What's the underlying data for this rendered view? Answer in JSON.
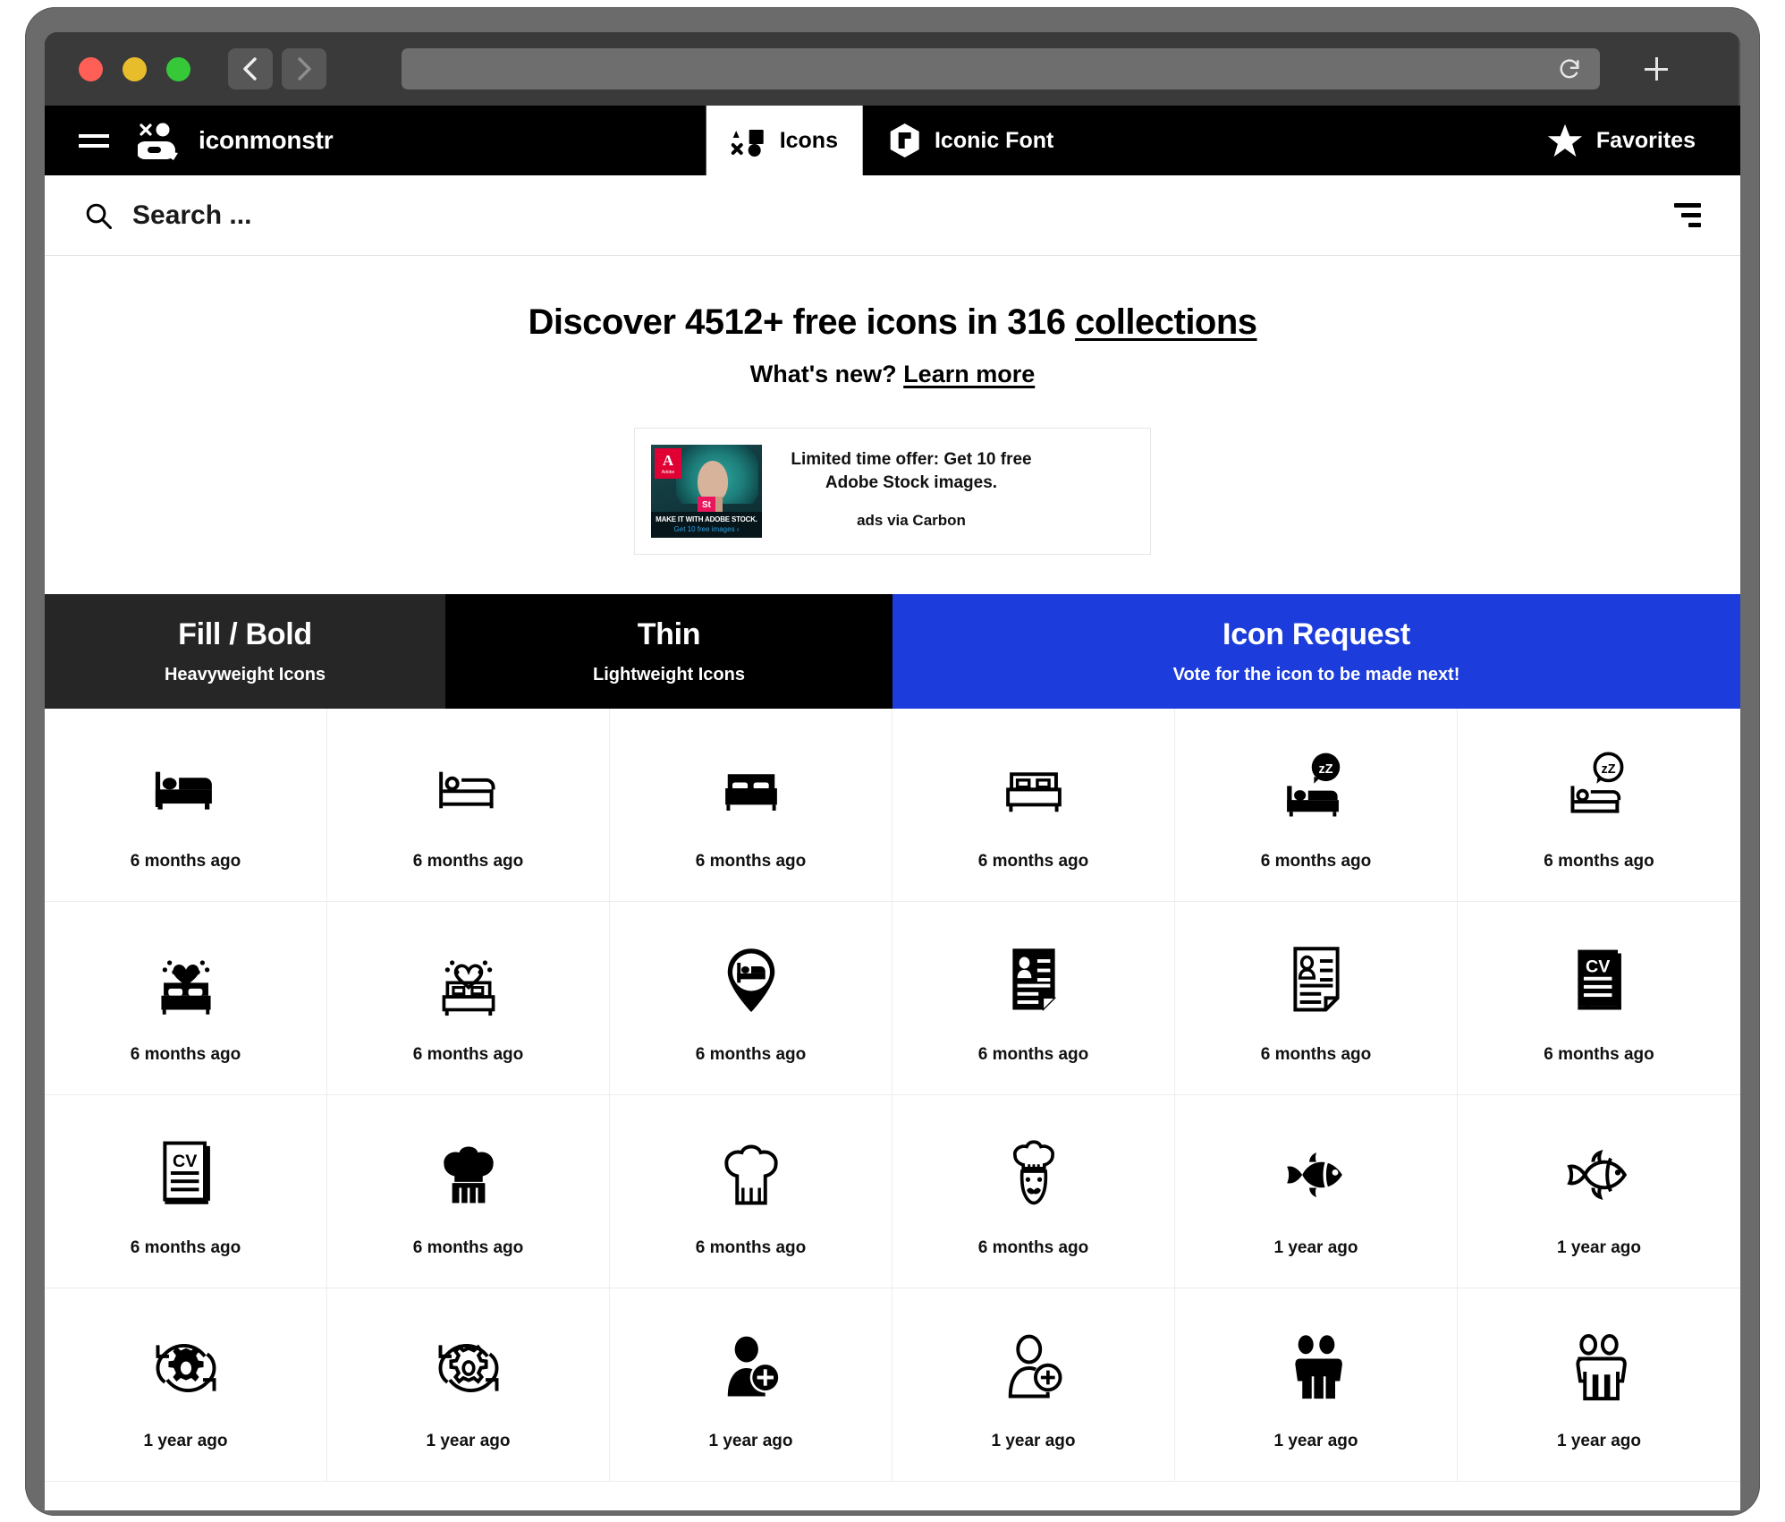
{
  "browser": {
    "traffic_lights": [
      "close",
      "minimize",
      "maximize"
    ],
    "back_label": "Back",
    "forward_label": "Forward",
    "reload_label": "Reload",
    "url_value": "",
    "new_tab_label": "New Tab"
  },
  "topnav": {
    "menu_label": "Menu",
    "brand": "iconmonstr",
    "tabs": [
      {
        "label": "Icons",
        "icon": "shapes-icon",
        "active": true
      },
      {
        "label": "Iconic Font",
        "icon": "hexagon-font-icon",
        "active": false
      }
    ],
    "favorites_label": "Favorites"
  },
  "search": {
    "placeholder": "Search ...",
    "value": "",
    "filter_label": "Filter"
  },
  "hero": {
    "headline_prefix": "Discover 4512+ free icons in 316 ",
    "headline_link": "collections",
    "icon_count": "4512+",
    "collection_count": "316",
    "sub_prefix": "What's new? ",
    "sub_link": "Learn more"
  },
  "ad": {
    "title": "Limited time offer: Get 10 free Adobe Stock images.",
    "via": "ads via Carbon",
    "image_caption_line1": "MAKE IT WITH ADOBE STOCK.",
    "image_caption_line2": "Get 10 free images ›",
    "badge": "St",
    "brand_mark": "A",
    "brand_word": "Adobe"
  },
  "banners": [
    {
      "title": "Fill / Bold",
      "subtitle": "Heavyweight Icons",
      "color": "#262626"
    },
    {
      "title": "Thin",
      "subtitle": "Lightweight Icons",
      "color": "#000000"
    },
    {
      "title": "Icon Request",
      "subtitle": "Vote for the icon to be made next!",
      "color": "#1c3cdb"
    }
  ],
  "grid": {
    "items": [
      {
        "icon": "bed-sleep-filled-icon",
        "age": "6 months ago"
      },
      {
        "icon": "bed-sleep-thin-icon",
        "age": "6 months ago"
      },
      {
        "icon": "bed-double-filled-icon",
        "age": "6 months ago"
      },
      {
        "icon": "bed-double-thin-icon",
        "age": "6 months ago"
      },
      {
        "icon": "sleeping-zz-filled-icon",
        "age": "6 months ago"
      },
      {
        "icon": "sleeping-zz-thin-icon",
        "age": "6 months ago"
      },
      {
        "icon": "honeymoon-bed-heart-filled-icon",
        "age": "6 months ago"
      },
      {
        "icon": "honeymoon-bed-heart-thin-icon",
        "age": "6 months ago"
      },
      {
        "icon": "hotel-location-pin-icon",
        "age": "6 months ago"
      },
      {
        "icon": "resume-document-filled-icon",
        "age": "6 months ago"
      },
      {
        "icon": "resume-document-thin-icon",
        "age": "6 months ago"
      },
      {
        "icon": "cv-document-filled-icon",
        "age": "6 months ago"
      },
      {
        "icon": "cv-document-thin-icon",
        "age": "6 months ago"
      },
      {
        "icon": "chef-hat-filled-icon",
        "age": "6 months ago"
      },
      {
        "icon": "chef-hat-thin-icon",
        "age": "6 months ago"
      },
      {
        "icon": "chef-face-thin-icon",
        "age": "6 months ago"
      },
      {
        "icon": "fish-filled-icon",
        "age": "1 year ago"
      },
      {
        "icon": "fish-thin-icon",
        "age": "1 year ago"
      },
      {
        "icon": "gear-refresh-filled-icon",
        "age": "1 year ago"
      },
      {
        "icon": "gear-refresh-thin-icon",
        "age": "1 year ago"
      },
      {
        "icon": "user-add-filled-icon",
        "age": "1 year ago"
      },
      {
        "icon": "user-add-thin-icon",
        "age": "1 year ago"
      },
      {
        "icon": "two-people-filled-icon",
        "age": "1 year ago"
      },
      {
        "icon": "two-people-thin-icon",
        "age": "1 year ago"
      }
    ]
  }
}
